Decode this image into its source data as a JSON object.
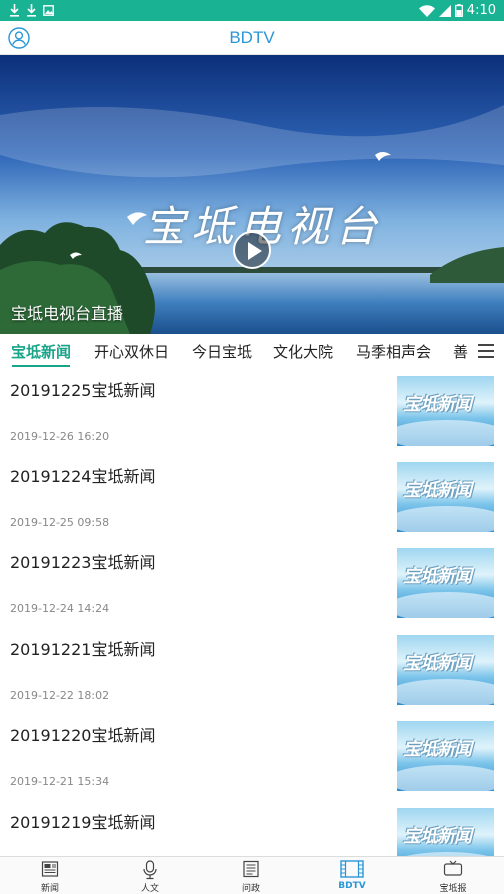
{
  "status_bar": {
    "time": "4:10",
    "left_icons": [
      "download-icon",
      "download-icon",
      "photo-icon"
    ],
    "right_icons": [
      "wifi-icon",
      "signal-icon",
      "battery-icon"
    ],
    "color": "#19b394"
  },
  "header": {
    "title": "BDTV",
    "title_color": "#2a96d8",
    "profile_icon": "profile-icon"
  },
  "banner": {
    "calligraphy": "宝坻电视台",
    "caption": "宝坻电视台直播",
    "play_icon": "play-icon",
    "page_indicator": {
      "current": 1,
      "total": 1
    }
  },
  "tabs": {
    "items": [
      "宝坻新闻",
      "开心双休日",
      "今日宝坻",
      "文化大院",
      "马季相声会",
      "善"
    ],
    "active_index": 0,
    "active_color": "#19a589",
    "menu_icon": "menu-icon"
  },
  "news": {
    "items": [
      {
        "title": "20191225宝坻新闻",
        "date": "2019-12-26 16:20",
        "thumb_text": "宝坻新闻"
      },
      {
        "title": "20191224宝坻新闻",
        "date": "2019-12-25 09:58",
        "thumb_text": "宝坻新闻"
      },
      {
        "title": "20191223宝坻新闻",
        "date": "2019-12-24 14:24",
        "thumb_text": "宝坻新闻"
      },
      {
        "title": "20191221宝坻新闻",
        "date": "2019-12-22 18:02",
        "thumb_text": "宝坻新闻"
      },
      {
        "title": "20191220宝坻新闻",
        "date": "2019-12-21 15:34",
        "thumb_text": "宝坻新闻"
      },
      {
        "title": "20191219宝坻新闻",
        "date": "",
        "thumb_text": "宝坻新闻"
      }
    ]
  },
  "bottom_nav": {
    "items": [
      {
        "label": "新闻",
        "icon": "newspaper-icon"
      },
      {
        "label": "人文",
        "icon": "microphone-icon"
      },
      {
        "label": "问政",
        "icon": "document-icon"
      },
      {
        "label": "BDTV",
        "icon": "film-icon"
      },
      {
        "label": "宝坻报",
        "icon": "tv-icon"
      }
    ],
    "active_index": 3,
    "active_color": "#2a96d8"
  }
}
